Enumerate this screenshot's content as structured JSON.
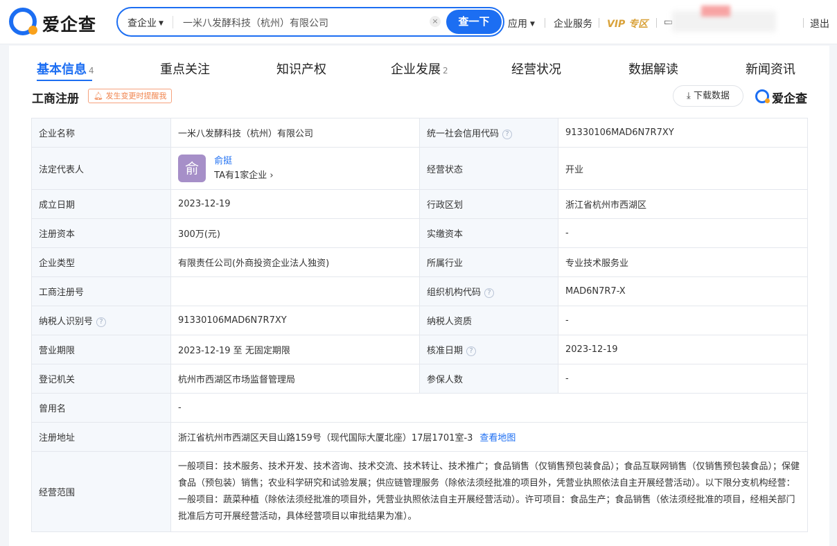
{
  "header": {
    "logo_text": "爱企查",
    "search": {
      "scope": "查企业",
      "query": "一米八发酵科技（杭州）有限公司",
      "button": "查一下"
    },
    "nav": {
      "apps": "应用",
      "enterprise_service": "企业服务",
      "vip": "VIP 专区",
      "logout": "退出"
    }
  },
  "tabs": [
    {
      "label": "基本信息",
      "count": "4"
    },
    {
      "label": "重点关注",
      "count": ""
    },
    {
      "label": "知识产权",
      "count": ""
    },
    {
      "label": "企业发展",
      "count": "2"
    },
    {
      "label": "经营状况",
      "count": ""
    },
    {
      "label": "数据解读",
      "count": ""
    },
    {
      "label": "新闻资讯",
      "count": ""
    }
  ],
  "section": {
    "title": "工商注册",
    "remind": "发生变更时提醒我",
    "download": "下载数据",
    "brand": "爱企查"
  },
  "info": {
    "company_name_label": "企业名称",
    "company_name": "一米八发酵科技（杭州）有限公司",
    "credit_code_label": "统一社会信用代码",
    "credit_code": "91330106MAD6N7R7XY",
    "legal_rep_label": "法定代表人",
    "legal_rep_avatar": "俞",
    "legal_rep_name": "俞挺",
    "legal_rep_companies": "TA有1家企业",
    "status_label": "经营状态",
    "status": "开业",
    "found_date_label": "成立日期",
    "found_date": "2023-12-19",
    "region_label": "行政区划",
    "region": "浙江省杭州市西湖区",
    "reg_capital_label": "注册资本",
    "reg_capital": "300万(元)",
    "paid_capital_label": "实缴资本",
    "paid_capital": "-",
    "type_label": "企业类型",
    "type": "有限责任公司(外商投资企业法人独资)",
    "industry_label": "所属行业",
    "industry": "专业技术服务业",
    "reg_no_label": "工商注册号",
    "reg_no": "",
    "org_code_label": "组织机构代码",
    "org_code": "MAD6N7R7-X",
    "taxpayer_id_label": "纳税人识别号",
    "taxpayer_id": "91330106MAD6N7R7XY",
    "taxpayer_qual_label": "纳税人资质",
    "taxpayer_qual": "-",
    "term_label": "营业期限",
    "term": "2023-12-19 至 无固定期限",
    "approve_date_label": "核准日期",
    "approve_date": "2023-12-19",
    "authority_label": "登记机关",
    "authority": "杭州市西湖区市场监督管理局",
    "insured_label": "参保人数",
    "insured": "-",
    "former_name_label": "曾用名",
    "former_name": "-",
    "address_label": "注册地址",
    "address": "浙江省杭州市西湖区天目山路159号（现代国际大厦北座）17层1701室-3",
    "map_link": "查看地图",
    "scope_label": "经营范围",
    "scope": "一般项目：技术服务、技术开发、技术咨询、技术交流、技术转让、技术推广；食品销售（仅销售预包装食品）；食品互联网销售（仅销售预包装食品）；保健食品（预包装）销售；农业科学研究和试验发展；供应链管理服务（除依法须经批准的项目外，凭营业执照依法自主开展经营活动）。以下限分支机构经营：一般项目：蔬菜种植（除依法须经批准的项目外，凭营业执照依法自主开展经营活动）。许可项目：食品生产；食品销售（依法须经批准的项目，经相关部门批准后方可开展经营活动，具体经营项目以审批结果为准）。"
  }
}
